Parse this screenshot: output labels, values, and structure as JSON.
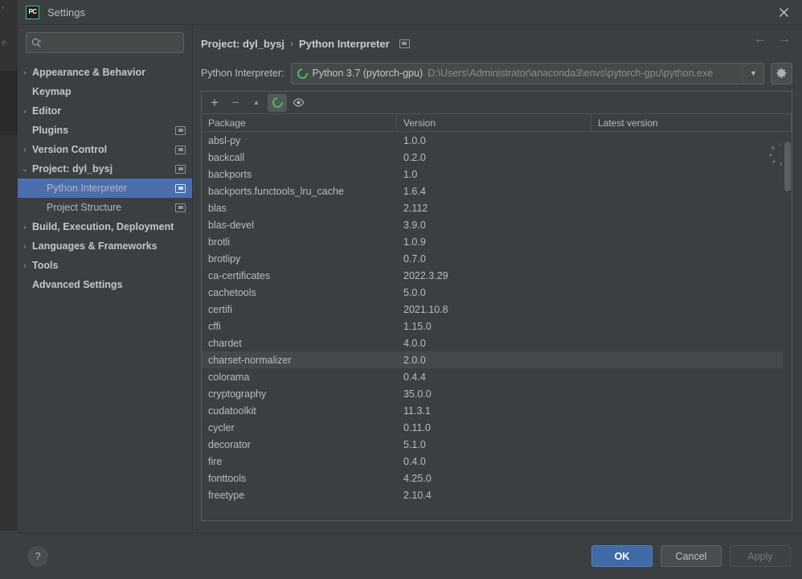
{
  "background_window": {
    "line1": "‹",
    "line2": "e·"
  },
  "titlebar": {
    "logo_text": "PC",
    "title": "Settings",
    "close_icon": "close-icon"
  },
  "sidebar": {
    "search": {
      "value": "",
      "placeholder": "",
      "icon": "search-icon",
      "dropdown_icon": "chevron-down-icon"
    },
    "items": [
      {
        "label": "Appearance & Behavior",
        "arrow": "›",
        "expandable": true,
        "bold": true,
        "child": false,
        "badge": false,
        "selected": false
      },
      {
        "label": "Keymap",
        "arrow": "",
        "expandable": false,
        "bold": true,
        "child": false,
        "badge": false,
        "selected": false
      },
      {
        "label": "Editor",
        "arrow": "›",
        "expandable": true,
        "bold": true,
        "child": false,
        "badge": false,
        "selected": false
      },
      {
        "label": "Plugins",
        "arrow": "",
        "expandable": false,
        "bold": true,
        "child": false,
        "badge": true,
        "selected": false
      },
      {
        "label": "Version Control",
        "arrow": "›",
        "expandable": true,
        "bold": true,
        "child": false,
        "badge": true,
        "selected": false
      },
      {
        "label": "Project: dyl_bysj",
        "arrow": "⌄",
        "expandable": true,
        "bold": true,
        "child": false,
        "badge": true,
        "selected": false
      },
      {
        "label": "Python Interpreter",
        "arrow": "",
        "expandable": false,
        "bold": false,
        "child": true,
        "badge": true,
        "selected": true
      },
      {
        "label": "Project Structure",
        "arrow": "",
        "expandable": false,
        "bold": false,
        "child": true,
        "badge": true,
        "selected": false
      },
      {
        "label": "Build, Execution, Deployment",
        "arrow": "›",
        "expandable": true,
        "bold": true,
        "child": false,
        "badge": false,
        "selected": false
      },
      {
        "label": "Languages & Frameworks",
        "arrow": "›",
        "expandable": true,
        "bold": true,
        "child": false,
        "badge": false,
        "selected": false
      },
      {
        "label": "Tools",
        "arrow": "›",
        "expandable": true,
        "bold": true,
        "child": false,
        "badge": false,
        "selected": false
      },
      {
        "label": "Advanced Settings",
        "arrow": "",
        "expandable": false,
        "bold": true,
        "child": false,
        "badge": false,
        "selected": false
      }
    ]
  },
  "main": {
    "breadcrumb": {
      "project": "Project: dyl_bysj",
      "separator": "›",
      "page": "Python Interpreter",
      "badge_icon": "project-scope-icon"
    },
    "nav": {
      "back_icon": "arrow-left-icon",
      "forward_icon": "arrow-right-icon"
    },
    "interpreter": {
      "label": "Python Interpreter:",
      "status_icon": "python-env-ring-icon",
      "name": "Python 3.7 (pytorch-gpu)",
      "path": "D:\\Users\\Administrator\\anaconda3\\envs\\pytorch-gpu\\python.exe",
      "dropdown_icon": "chevron-down-icon",
      "gear_icon": "gear-icon"
    },
    "packages_toolbar": [
      {
        "name": "add-package-button",
        "icon": "plus-icon",
        "glyph": "+",
        "active": false,
        "enabled": true
      },
      {
        "name": "remove-package-button",
        "icon": "minus-icon",
        "glyph": "−",
        "active": false,
        "enabled": false
      },
      {
        "name": "upgrade-package-button",
        "icon": "arrow-up-icon",
        "glyph": "▲",
        "active": false,
        "enabled": false
      },
      {
        "name": "refresh-packages-button",
        "icon": "refresh-ring-icon",
        "glyph": "",
        "active": true,
        "enabled": true
      },
      {
        "name": "show-early-releases-button",
        "icon": "eye-icon",
        "glyph": "",
        "active": false,
        "enabled": true
      }
    ],
    "packages_table": {
      "columns": [
        "Package",
        "Version",
        "Latest version"
      ],
      "rows": [
        {
          "package": "absl-py",
          "version": "1.0.0",
          "latest": "",
          "loading": true,
          "hovered": false
        },
        {
          "package": "backcall",
          "version": "0.2.0",
          "latest": "",
          "loading": false,
          "hovered": false
        },
        {
          "package": "backports",
          "version": "1.0",
          "latest": "",
          "loading": false,
          "hovered": false
        },
        {
          "package": "backports.functools_lru_cache",
          "version": "1.6.4",
          "latest": "",
          "loading": false,
          "hovered": false
        },
        {
          "package": "blas",
          "version": "2.112",
          "latest": "",
          "loading": false,
          "hovered": false
        },
        {
          "package": "blas-devel",
          "version": "3.9.0",
          "latest": "",
          "loading": false,
          "hovered": false
        },
        {
          "package": "brotli",
          "version": "1.0.9",
          "latest": "",
          "loading": false,
          "hovered": false
        },
        {
          "package": "brotlipy",
          "version": "0.7.0",
          "latest": "",
          "loading": false,
          "hovered": false
        },
        {
          "package": "ca-certificates",
          "version": "2022.3.29",
          "latest": "",
          "loading": false,
          "hovered": false
        },
        {
          "package": "cachetools",
          "version": "5.0.0",
          "latest": "",
          "loading": false,
          "hovered": false
        },
        {
          "package": "certifi",
          "version": "2021.10.8",
          "latest": "",
          "loading": false,
          "hovered": false
        },
        {
          "package": "cffi",
          "version": "1.15.0",
          "latest": "",
          "loading": false,
          "hovered": false
        },
        {
          "package": "chardet",
          "version": "4.0.0",
          "latest": "",
          "loading": false,
          "hovered": false
        },
        {
          "package": "charset-normalizer",
          "version": "2.0.0",
          "latest": "",
          "loading": false,
          "hovered": true
        },
        {
          "package": "colorama",
          "version": "0.4.4",
          "latest": "",
          "loading": false,
          "hovered": false
        },
        {
          "package": "cryptography",
          "version": "35.0.0",
          "latest": "",
          "loading": false,
          "hovered": false
        },
        {
          "package": "cudatoolkit",
          "version": "11.3.1",
          "latest": "",
          "loading": false,
          "hovered": false
        },
        {
          "package": "cycler",
          "version": "0.11.0",
          "latest": "",
          "loading": false,
          "hovered": false
        },
        {
          "package": "decorator",
          "version": "5.1.0",
          "latest": "",
          "loading": false,
          "hovered": false
        },
        {
          "package": "fire",
          "version": "0.4.0",
          "latest": "",
          "loading": false,
          "hovered": false
        },
        {
          "package": "fonttools",
          "version": "4.25.0",
          "latest": "",
          "loading": false,
          "hovered": false
        },
        {
          "package": "freetype",
          "version": "2.10.4",
          "latest": "",
          "loading": false,
          "hovered": false
        }
      ]
    }
  },
  "footer": {
    "help_label": "?",
    "ok_label": "OK",
    "cancel_label": "Cancel",
    "apply_label": "Apply"
  },
  "colors": {
    "window_bg": "#3c3f41",
    "selection_blue": "#4b6eaf",
    "primary_button": "#3f6ba8",
    "accent_green": "#4fbf57",
    "text": "#bbbbbb"
  }
}
